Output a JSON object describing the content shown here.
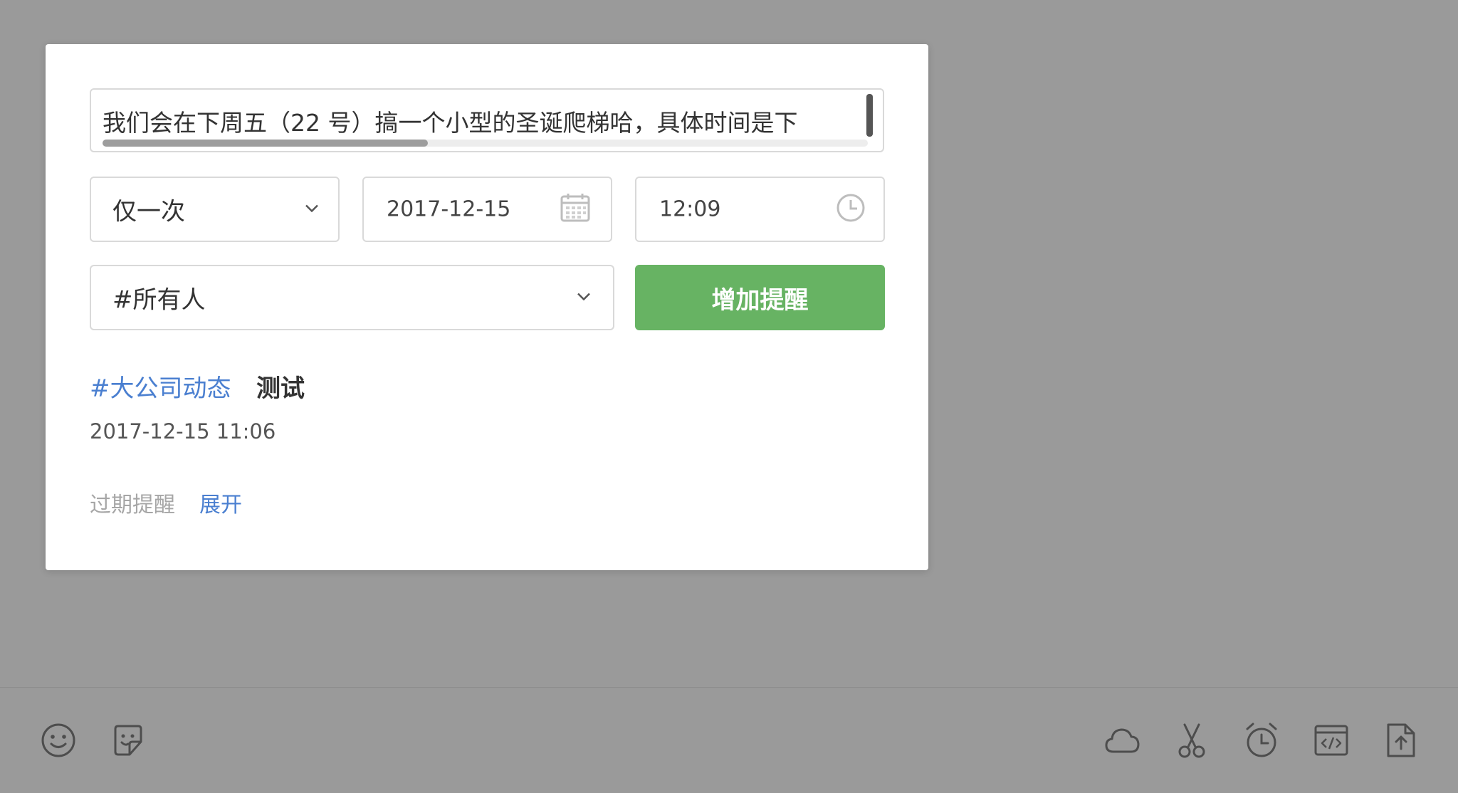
{
  "reminder_form": {
    "message_value": "我们会在下周五（22 号）搞一个小型的圣诞爬梯哈，具体时间是下",
    "repeat": {
      "selected": "仅一次",
      "icon": "chevron-down-icon"
    },
    "date": {
      "value": "2017-12-15",
      "icon": "calendar-icon"
    },
    "time": {
      "value": "12:09",
      "icon": "clock-icon"
    },
    "target": {
      "selected": "#所有人",
      "icon": "chevron-down-icon"
    },
    "add_button_label": "增加提醒"
  },
  "reminders": [
    {
      "channel": "#大公司动态",
      "text": "测试",
      "time": "2017-12-15 11:06"
    }
  ],
  "expired": {
    "label": "过期提醒",
    "expand_label": "展开"
  },
  "toolbar": {
    "left": [
      "emoji-icon",
      "sticker-icon"
    ],
    "right": [
      "cloud-icon",
      "scissors-icon",
      "alarm-icon",
      "code-icon",
      "file-upload-icon"
    ]
  },
  "colors": {
    "overlay": "#9a9a9a",
    "primary_button": "#67b363",
    "link": "#4a7fd0"
  }
}
